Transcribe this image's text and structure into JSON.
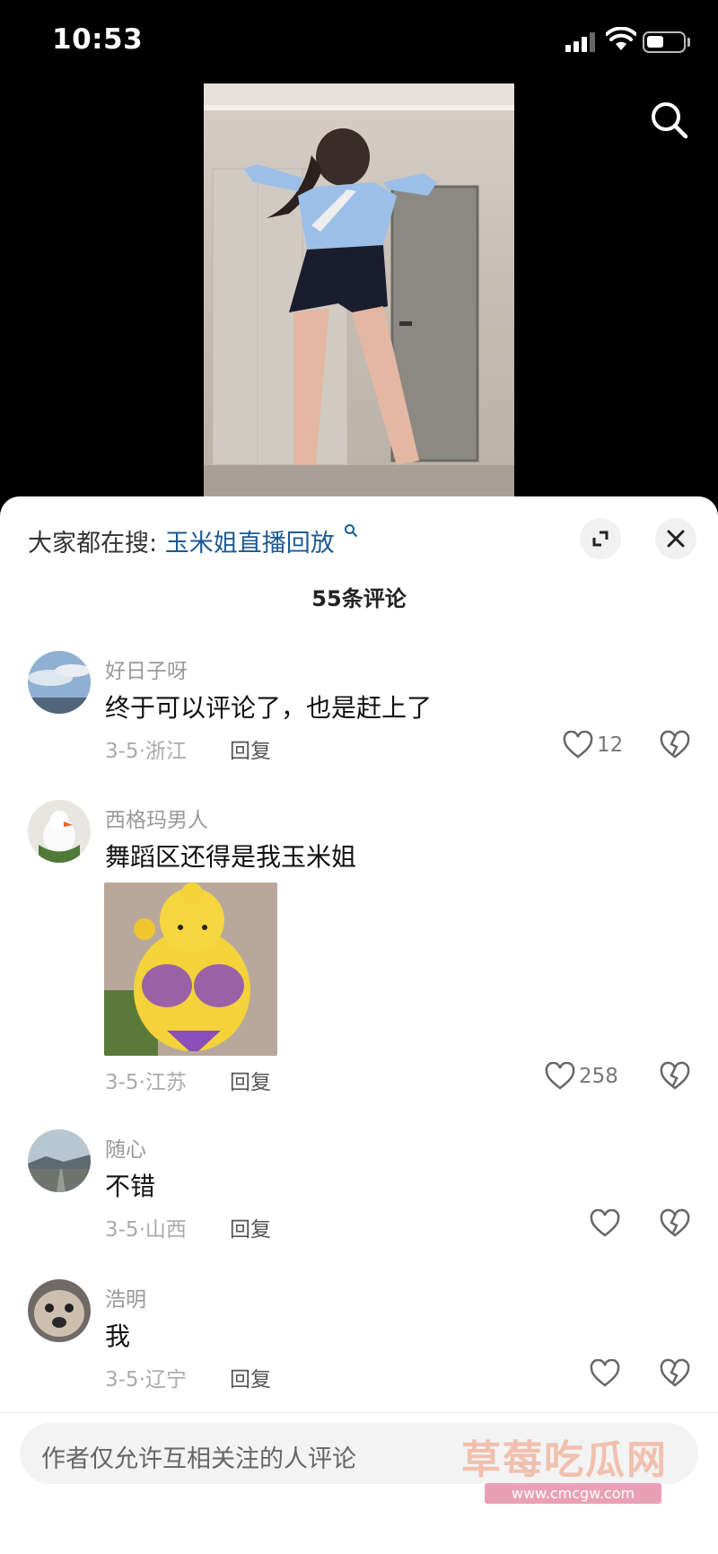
{
  "status_bar": {
    "time": "10:53"
  },
  "trending": {
    "prefix": "大家都在搜:",
    "query": "玉米姐直播回放"
  },
  "comments_count_label": "55条评论",
  "comments": [
    {
      "user": "好日子呀",
      "text": "终于可以评论了，也是赶上了",
      "date_location": "3-5·浙江",
      "reply_label": "回复",
      "likes": "12"
    },
    {
      "user": "西格玛男人",
      "text": "舞蹈区还得是我玉米姐",
      "date_location": "3-5·江苏",
      "reply_label": "回复",
      "likes": "258"
    },
    {
      "user": "随心",
      "text": "不错",
      "date_location": "3-5·山西",
      "reply_label": "回复",
      "likes": ""
    },
    {
      "user": "浩明",
      "text": "我",
      "date_location": "3-5·辽宁",
      "reply_label": "回复",
      "likes": ""
    }
  ],
  "input": {
    "placeholder": "作者仅允许互相关注的人评论"
  },
  "watermark": {
    "title": "草莓吃瓜网",
    "url": "www.cmcgw.com"
  },
  "icons": [
    "search-icon",
    "expand-icon",
    "close-icon",
    "heart-icon",
    "broken-heart-icon"
  ],
  "colors": {
    "link": "#1d5a92",
    "sheet_background": "#ffffff",
    "app_background": "#000000"
  }
}
